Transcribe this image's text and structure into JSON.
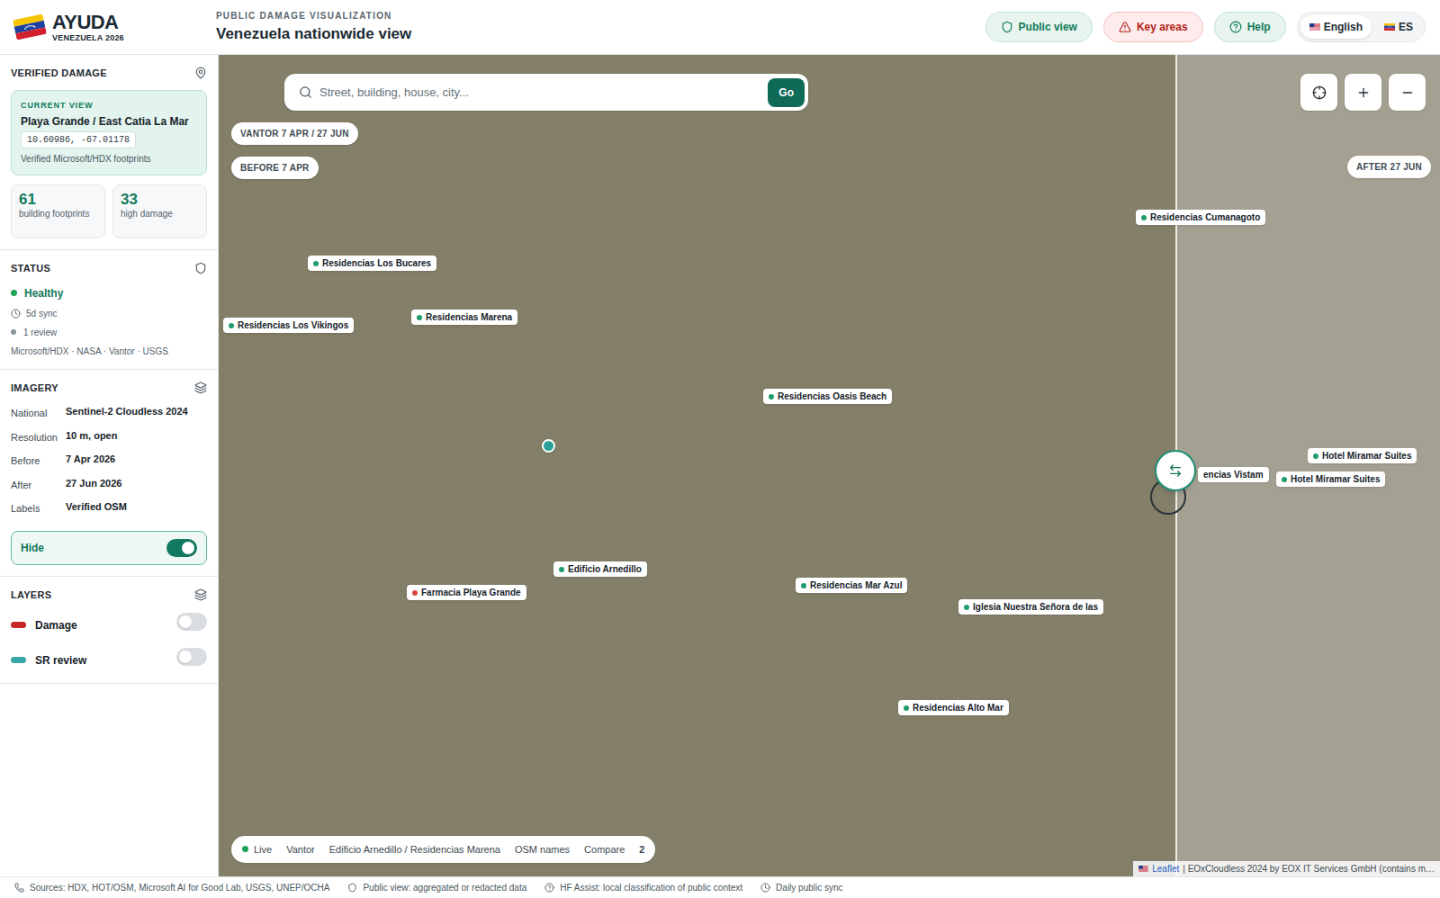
{
  "header": {
    "brand": "AYUDA",
    "brand_sub": "VENEZUELA 2026",
    "eyebrow": "PUBLIC DAMAGE VISUALIZATION",
    "title": "Venezuela nationwide view",
    "buttons": [
      {
        "label": "Public view",
        "kind": "public"
      },
      {
        "label": "Key areas",
        "kind": "alert"
      },
      {
        "label": "Help",
        "kind": "help"
      }
    ],
    "languages": [
      {
        "label": "English",
        "selected": true
      },
      {
        "label": "ES",
        "selected": false
      }
    ]
  },
  "sidebar": {
    "verified_damage": {
      "title": "VERIFIED DAMAGE",
      "current_view": {
        "eyebrow": "CURRENT VIEW",
        "name": "Playa Grande / East Catia La Mar",
        "coords": "10.60986, -67.01178",
        "note": "Verified Microsoft/HDX footprints"
      },
      "stats": [
        {
          "value": "61",
          "label": "building footprints"
        },
        {
          "value": "33",
          "label": "high damage"
        }
      ]
    },
    "status": {
      "title": "STATUS",
      "health": "Healthy",
      "sync": "5d sync",
      "reviews": "1 review",
      "sources": "Microsoft/HDX · NASA · Vantor · USGS"
    },
    "imagery": {
      "title": "IMAGERY",
      "rows": [
        {
          "label": "National",
          "value": "Sentinel-2 Cloudless 2024"
        },
        {
          "label": "Resolution",
          "value": "10 m, open"
        },
        {
          "label": "Before",
          "value": "7 Apr 2026"
        },
        {
          "label": "After",
          "value": "27 Jun 2026"
        },
        {
          "label": "Labels",
          "value": "Verified OSM"
        }
      ],
      "toggle": {
        "label": "Hide",
        "on": true
      }
    },
    "layers": {
      "title": "LAYERS",
      "items": [
        {
          "label": "Damage",
          "on": false,
          "color": "#c62828"
        },
        {
          "label": "SR review",
          "on": false,
          "color": "#3aa7a7"
        }
      ]
    }
  },
  "map": {
    "search": {
      "placeholder": "Street, building, house, city...",
      "button": "Go"
    },
    "badges_left": [
      "VANTOR 7 APR / 27 JUN",
      "BEFORE 7 APR"
    ],
    "badge_right": "AFTER 27 JUN",
    "compare": {
      "level": 0.783
    },
    "labels": [
      {
        "text": "Residencias Los Bucares",
        "kind": "pin",
        "color": "#1f9d6b"
      },
      {
        "text": "Residencias Los Vikingos",
        "kind": "pin",
        "color": "#1f9d6b"
      },
      {
        "text": "Residencias Marena",
        "kind": "pin",
        "color": "#1f9d6b"
      },
      {
        "text": "Residencias Oasis Beach",
        "kind": "pin",
        "color": "#1f9d6b"
      },
      {
        "text": "Residencias Cumanagoto",
        "kind": "pin",
        "color": "#1f9d6b"
      },
      {
        "text": "encias Vistam",
        "kind": "clipped"
      },
      {
        "text": "Hotel Miramar Suites",
        "kind": "pin",
        "color": "#1f9d6b"
      },
      {
        "text": "Hotel Miramar Suites",
        "kind": "pin",
        "color": "#1f9d6b"
      },
      {
        "text": "Edificio Arnedillo",
        "kind": "pin",
        "color": "#1f9d6b"
      },
      {
        "text": "Farmacia Playa Grande",
        "kind": "pin",
        "color": "#d64545"
      },
      {
        "text": "Residencias Mar Azul",
        "kind": "pin",
        "color": "#1f9d6b"
      },
      {
        "text": "Iglesia Nuestra Señora de las",
        "kind": "pin",
        "color": "#1f9d6b"
      },
      {
        "text": "Residencias Alto Mar",
        "kind": "pin",
        "color": "#1f9d6b"
      }
    ],
    "bottom_bar": [
      {
        "text": "Live",
        "kind": "live"
      },
      {
        "text": "Vantor",
        "kind": "plain"
      },
      {
        "text": "Edificio Arnedillo / Residencias Marena",
        "kind": "plain"
      },
      {
        "text": "OSM names",
        "kind": "plain"
      },
      {
        "text": "Compare",
        "kind": "plain"
      },
      {
        "text": "2",
        "kind": "count"
      }
    ],
    "attribution": {
      "link": "Leaflet",
      "text": "| EOxCloudless 2024 by EOX IT Services GmbH (contains m…"
    }
  },
  "status_bar": [
    "Sources: HDX, HOT/OSM, Microsoft AI for Good Lab, USGS, UNEP/OCHA",
    "Public view: aggregated or redacted data",
    "HF Assist: local classification of public context",
    "Daily public sync"
  ]
}
